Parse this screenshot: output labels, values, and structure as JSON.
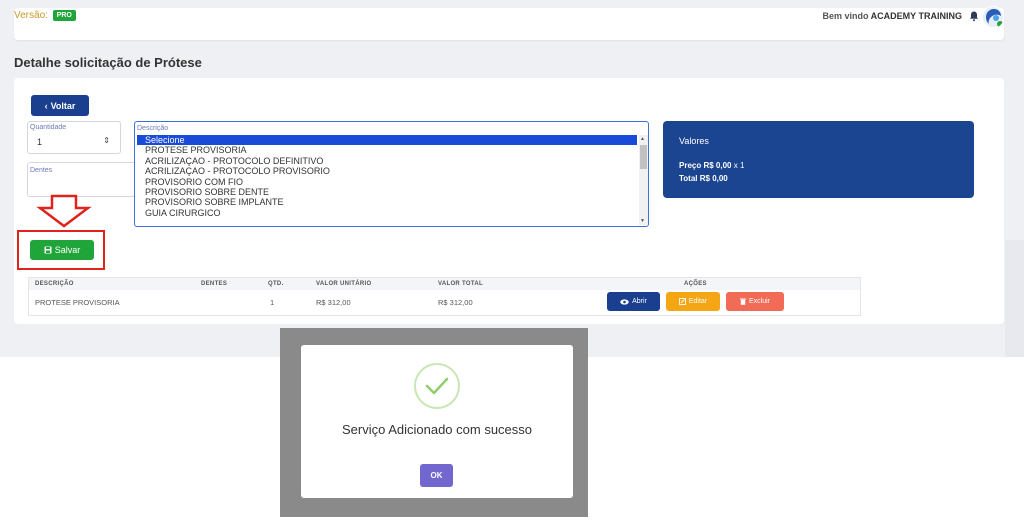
{
  "header": {
    "version_label": "Versão:",
    "version_badge": "PRO",
    "welcome_prefix": "Bem vindo",
    "user_name": "ACADEMY TRAINING",
    "bell_icon": "bell-icon",
    "avatar_icon": "user-avatar-icon"
  },
  "page": {
    "title": "Detalhe solicitação de Prótese",
    "back_label": "Voltar"
  },
  "form": {
    "quantity_label": "Quantidade",
    "quantity_value": "1",
    "teeth_label": "Dentes",
    "description_label": "Descrição",
    "description_options": [
      "Selecione",
      "PROTESE PROVISORIA",
      "ACRILIZAÇAO - PROTOCOLO DEFINITIVO",
      "ACRILIZAÇAO - PROTOCOLO PROVISORIO",
      "PROVISORIO COM FIO",
      "PROVISORIO SOBRE DENTE",
      "PROVISORIO SOBRE IMPLANTE",
      "GUIA CIRURGICO"
    ],
    "save_label": "Salvar"
  },
  "values_panel": {
    "title": "Valores",
    "price_label": "Preço R$ 0,00",
    "price_multiplier": "x 1",
    "total_label": "Total R$ 0,00"
  },
  "table": {
    "headers": {
      "description": "DESCRIÇÃO",
      "teeth": "DENTES",
      "qty": "QTD.",
      "unit_value": "VALOR UNITÁRIO",
      "total_value": "VALOR TOTAL",
      "actions": "AÇÕES"
    },
    "rows": [
      {
        "description": "PROTESE PROVISORIA",
        "teeth": "",
        "qty": "1",
        "unit_value": "R$ 312,00",
        "total_value": "R$ 312,00"
      }
    ],
    "actions": {
      "open_label": "Abrir",
      "edit_label": "Editar",
      "delete_label": "Excluir"
    }
  },
  "modal": {
    "message": "Serviço Adicionado com sucesso",
    "ok_label": "OK"
  },
  "colors": {
    "primary_blue": "#1b3f8f",
    "success_green": "#1fa53a",
    "warning_orange": "#f5a614",
    "danger_red": "#f26b57",
    "highlight_red": "#e0231d",
    "modal_button": "#7167cf"
  }
}
